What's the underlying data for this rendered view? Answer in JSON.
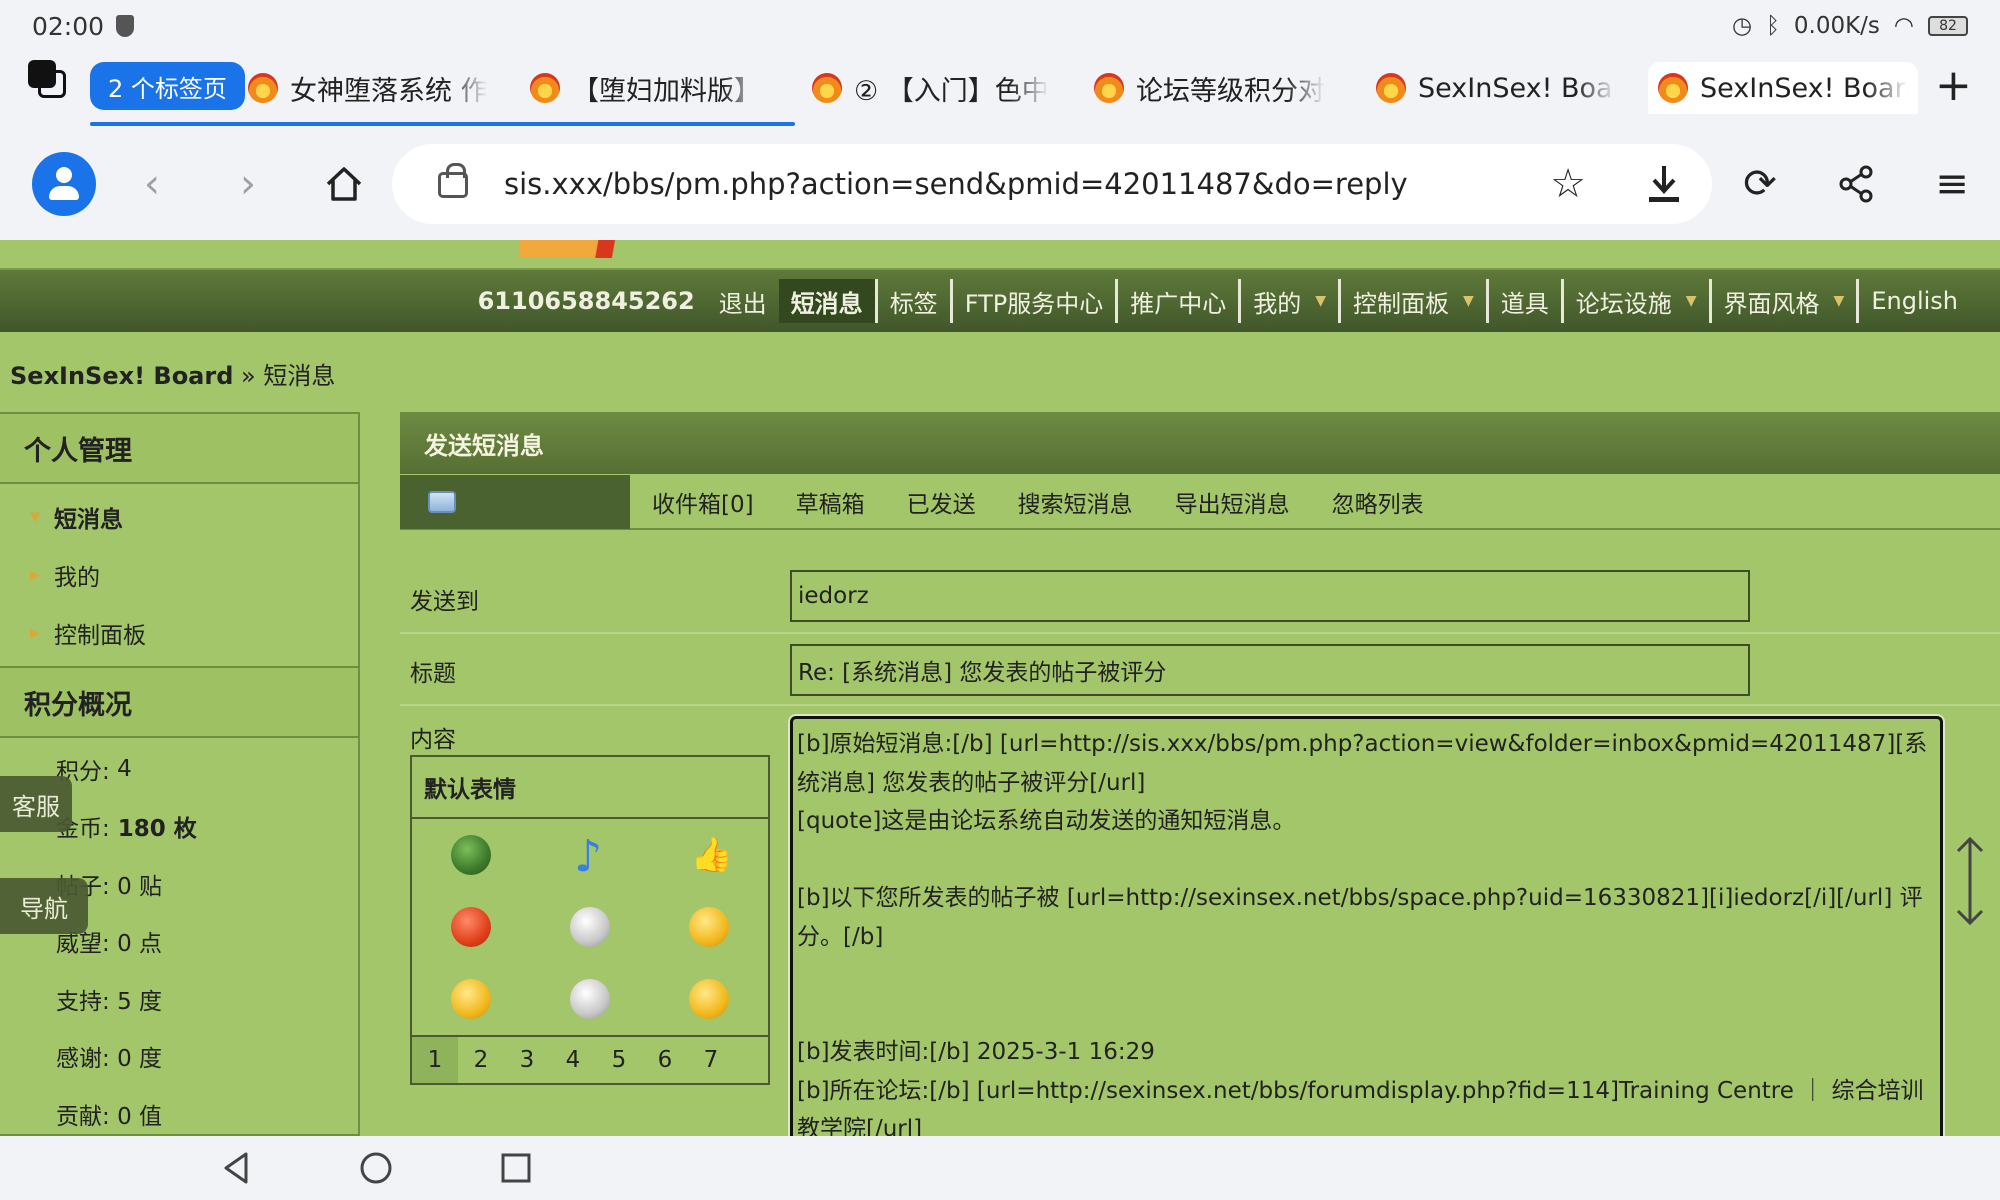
{
  "status_bar": {
    "time": "02:00",
    "net_speed": "0.00K/s",
    "battery": "82"
  },
  "tabs": {
    "group_label": "2 个标签页",
    "items": [
      {
        "title": "女神堕落系统 作"
      },
      {
        "title": "【堕妇加料版】"
      },
      {
        "title": "② 【入门】色中"
      },
      {
        "title": "论坛等级积分对"
      },
      {
        "title": "SexInSex! Boarc"
      },
      {
        "title": "SexInSex! Boarc"
      }
    ]
  },
  "address_bar": {
    "url": "sis.xxx/bbs/pm.php?action=send&pmid=42011487&do=reply"
  },
  "site_nav": {
    "user_id": "6110658845262",
    "items": [
      "退出",
      "短消息",
      "标签",
      "FTP服务中心",
      "推广中心",
      "我的",
      "控制面板",
      "道具",
      "论坛设施",
      "界面风格",
      "English"
    ]
  },
  "breadcrumb": {
    "home": "SexInSex! Board",
    "sep": "»",
    "current": "短消息"
  },
  "sidebar": {
    "personal_title": "个人管理",
    "personal_items": [
      "短消息",
      "我的",
      "控制面板"
    ],
    "credits_title": "积分概况",
    "credits": [
      {
        "label": "积分:",
        "value": "4"
      },
      {
        "label": "金币:",
        "value": "180 枚"
      },
      {
        "label": "帖子:",
        "value": "0 贴"
      },
      {
        "label": "威望:",
        "value": "0 点"
      },
      {
        "label": "支持:",
        "value": "5 度"
      },
      {
        "label": "感谢:",
        "value": "0 度"
      },
      {
        "label": "贡献:",
        "value": "0 值"
      }
    ],
    "float_buttons": [
      "客服",
      "导航"
    ]
  },
  "main": {
    "panel_title": "发送短消息",
    "subnav": [
      "收件箱[0]",
      "草稿箱",
      "已发送",
      "搜索短消息",
      "导出短消息",
      "忽略列表"
    ],
    "send_to_label": "发送到",
    "send_to_value": "iedorz",
    "subject_label": "标题",
    "subject_value": "Re: [系统消息] 您发表的帖子被评分",
    "content_label": "内容",
    "smiley_title": "默认表情",
    "smiley_icons": [
      "turtle-smiley-icon",
      "music-note-smiley-icon",
      "thumbs-up-smiley-icon",
      "angry-smiley-icon",
      "skull-smiley-icon",
      "cool-smiley-icon",
      "smirk-smiley-icon",
      "soccer-ball-smiley-icon",
      "sleepy-smiley-icon"
    ],
    "smiley_pages": [
      "1",
      "2",
      "3",
      "4",
      "5",
      "6",
      "7"
    ],
    "content_lines": [
      "[b]原始短消息:[/b] [url=http://sis.xxx/bbs/pm.php?action=view&folder=inbox&pmid=42011487][系统消息] 您发表的帖子被评分[/url]",
      "[quote]这是由论坛系统自动发送的通知短消息。",
      "",
      "[b]以下您所发表的帖子被 [url=http://sexinsex.net/bbs/space.php?uid=16330821][i]iedorz[/i][/url] 评分。[/b]",
      "",
      "",
      "[b]发表时间:[/b] 2025-3-1 16:29",
      "[b]所在论坛:[/b] [url=http://sexinsex.net/bbs/forumdisplay.php?fid=114]Training Centre ｜ 综合培训教学院[/url]"
    ]
  },
  "colors": {
    "page_bg": "#a3c66a",
    "nav_bg": "#4b6330",
    "accent_blue": "#1a73e8"
  }
}
